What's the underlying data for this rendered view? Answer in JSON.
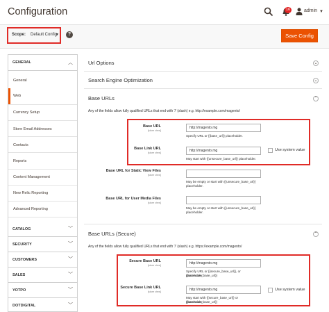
{
  "header": {
    "title": "Configuration",
    "notifications_count": "16",
    "user_name": "admin"
  },
  "toolbar": {
    "scope_label": "Scope:",
    "scope_value": "Default Config",
    "help": "?",
    "save_label": "Save Config"
  },
  "sidebar": {
    "general_title": "GENERAL",
    "items": [
      "General",
      "Web",
      "Currency Setup",
      "Store Email Addresses",
      "Contacts",
      "Reports",
      "Content Management",
      "New Relic Reporting",
      "Advanced Reporting"
    ],
    "active_item": "Web",
    "groups": [
      "CATALOG",
      "SECURITY",
      "CUSTOMERS",
      "SALES",
      "YOTPO",
      "DOTDIGITAL"
    ]
  },
  "sections": {
    "url_options": "Url Options",
    "seo": "Search Engine Optimization",
    "base_urls": "Base URLs",
    "base_urls_desc": "Any of the fields allow fully qualified URLs that end with '/' (slash) e.g. http://example.com/magento/",
    "base_urls_secure": "Base URLs (Secure)",
    "base_urls_secure_desc": "Any of the fields allow fully qualified URLs that end with '/' (slash) e.g. https://example.com/magento/"
  },
  "fields": {
    "store_view": "[store view]",
    "use_system_value": "Use system value",
    "base_url": {
      "label": "Base URL",
      "value": "http://magento.mg",
      "note": "Specify URL or {{base_url}} placeholder."
    },
    "base_link_url": {
      "label": "Base Link URL",
      "value": "http://magento.mg",
      "note": "May start with {{unsecure_base_url}} placeholder."
    },
    "static_url": {
      "label": "Base URL for Static View Files",
      "value": "",
      "note1": "May be empty or start with {{unsecure_base_url}}",
      "note2": "placeholder."
    },
    "media_url": {
      "label": "Base URL for User Media Files",
      "value": "",
      "note1": "May be empty or start with {{unsecure_base_url}}",
      "note2": "placeholder."
    },
    "secure_base_url": {
      "label": "Secure Base URL",
      "value": "http://magento.mg",
      "note1": "Specify URL or {{secure_base_url}}, or {{unsecure_base_url}}",
      "note2": "placeholder."
    },
    "secure_base_link_url": {
      "label": "Secure Base Link URL",
      "value": "http://magento.mg",
      "note1": "May start with {{secure_base_url}} or {{unsecure_base_url}}",
      "note2": "placeholder."
    }
  },
  "colors": {
    "accent": "#eb5202",
    "highlight": "#e02b27",
    "toolbar_bg": "#f8f8f8"
  },
  "icons": {
    "search": "search-icon",
    "notifications": "bell-icon",
    "user": "user-icon",
    "collapse": "chevron-up-icon",
    "expand": "chevron-down-icon",
    "section_toggle": "circle-toggle-icon"
  }
}
